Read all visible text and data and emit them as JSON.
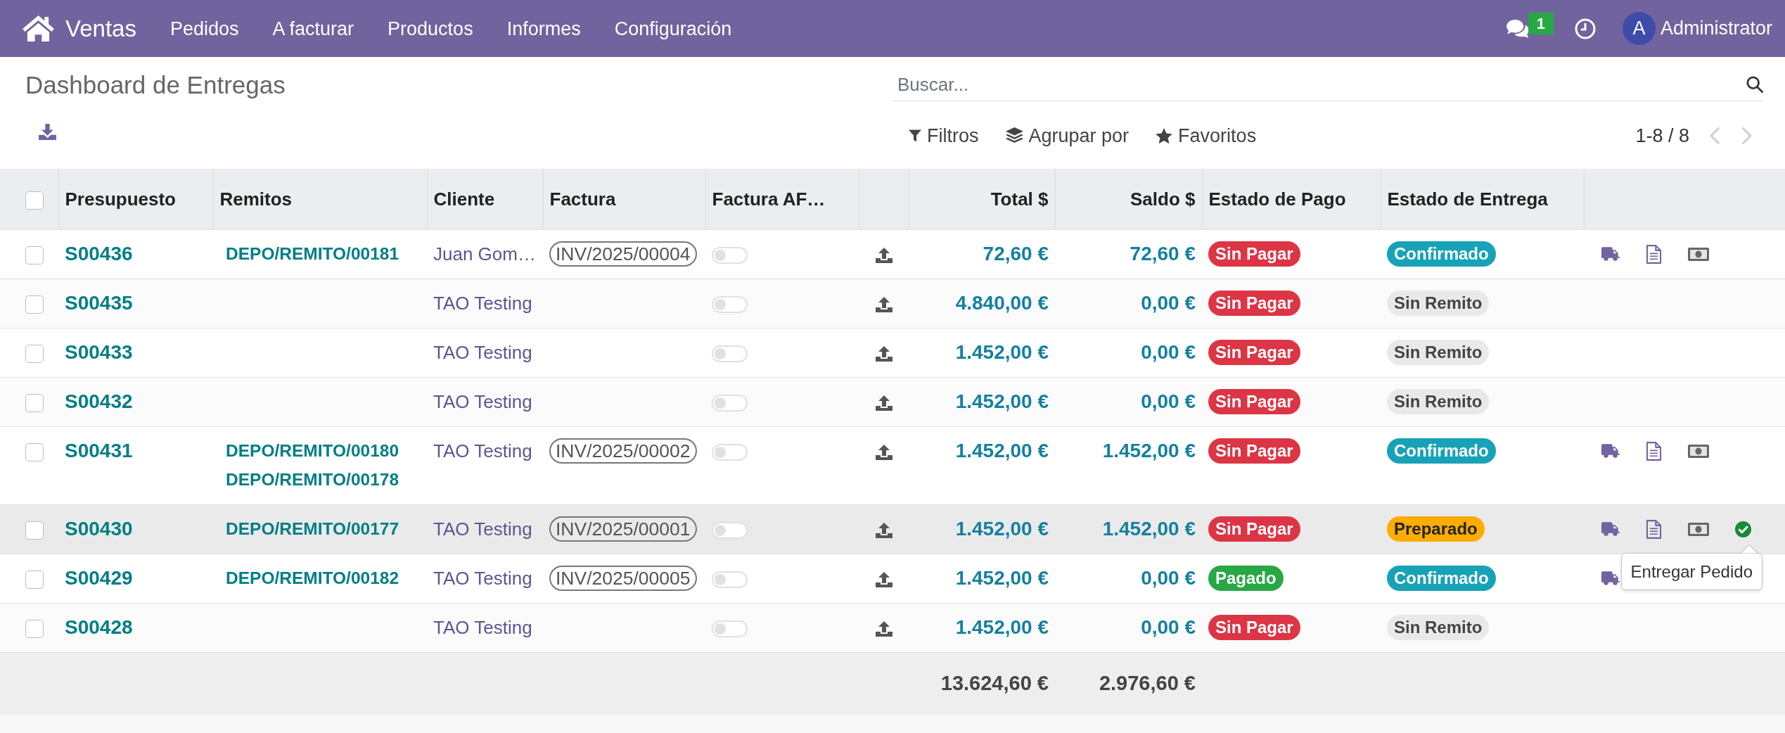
{
  "navbar": {
    "app_name": "Ventas",
    "menu": [
      "Pedidos",
      "A facturar",
      "Productos",
      "Informes",
      "Configuración"
    ],
    "messages_count": "1",
    "user": {
      "initial": "A",
      "name": "Administrator"
    }
  },
  "control_panel": {
    "title": "Dashboard de Entregas",
    "search": {
      "placeholder": "Buscar..."
    },
    "search_options": [
      {
        "kind": "filter",
        "label": "Filtros"
      },
      {
        "kind": "group_by",
        "label": "Agrupar por"
      },
      {
        "kind": "favorites",
        "label": "Favoritos"
      }
    ],
    "pager": {
      "value": "1-8 / 8",
      "previous_disabled": true,
      "next_disabled": true
    }
  },
  "table": {
    "select_all": {
      "checked": false
    },
    "columns": [
      "Presupuesto",
      "Remitos",
      "Cliente",
      "Factura",
      "Factura AF…",
      "Total $",
      "Saldo $",
      "Estado de Pago",
      "Estado de Entrega"
    ],
    "rows": [
      {
        "selected": false,
        "hovered": false,
        "quote": "S00436",
        "delivery_notes": [
          "DEPO/REMITO/00181"
        ],
        "customer": "Juan Gom…",
        "invoice": "INV/2025/00004",
        "toggle_on": false,
        "total": "72,60 €",
        "balance": "72,60 €",
        "payment_status": {
          "label": "Sin Pagar",
          "kind": "danger"
        },
        "delivery_status": {
          "label": "Confirmado",
          "kind": "info"
        },
        "actions": [
          {
            "kind": "delivery_note"
          },
          {
            "kind": "invoice"
          },
          {
            "kind": "payment"
          }
        ]
      },
      {
        "selected": false,
        "hovered": false,
        "quote": "S00435",
        "customer": "TAO Testing",
        "toggle_on": false,
        "total": "4.840,00 €",
        "balance": "0,00 €",
        "payment_status": {
          "label": "Sin Pagar",
          "kind": "danger"
        },
        "delivery_status": {
          "label": "Sin Remito",
          "kind": "muted"
        }
      },
      {
        "selected": false,
        "hovered": false,
        "quote": "S00433",
        "customer": "TAO Testing",
        "toggle_on": false,
        "total": "1.452,00 €",
        "balance": "0,00 €",
        "payment_status": {
          "label": "Sin Pagar",
          "kind": "danger"
        },
        "delivery_status": {
          "label": "Sin Remito",
          "kind": "muted"
        }
      },
      {
        "selected": false,
        "hovered": false,
        "quote": "S00432",
        "customer": "TAO Testing",
        "toggle_on": false,
        "total": "1.452,00 €",
        "balance": "0,00 €",
        "payment_status": {
          "label": "Sin Pagar",
          "kind": "danger"
        },
        "delivery_status": {
          "label": "Sin Remito",
          "kind": "muted"
        }
      },
      {
        "selected": false,
        "hovered": false,
        "quote": "S00431",
        "delivery_notes": [
          "DEPO/REMITO/00180",
          "DEPO/REMITO/00178"
        ],
        "customer": "TAO Testing",
        "invoice": "INV/2025/00002",
        "toggle_on": false,
        "total": "1.452,00 €",
        "balance": "1.452,00 €",
        "payment_status": {
          "label": "Sin Pagar",
          "kind": "danger"
        },
        "delivery_status": {
          "label": "Confirmado",
          "kind": "info"
        },
        "actions": [
          {
            "kind": "delivery_note"
          },
          {
            "kind": "invoice"
          },
          {
            "kind": "payment"
          }
        ]
      },
      {
        "selected": false,
        "hovered": true,
        "quote": "S00430",
        "delivery_notes": [
          "DEPO/REMITO/00177"
        ],
        "customer": "TAO Testing",
        "invoice": "INV/2025/00001",
        "toggle_on": false,
        "total": "1.452,00 €",
        "balance": "1.452,00 €",
        "payment_status": {
          "label": "Sin Pagar",
          "kind": "danger"
        },
        "delivery_status": {
          "label": "Preparado",
          "kind": "warning"
        },
        "actions": [
          {
            "kind": "delivery_note"
          },
          {
            "kind": "invoice"
          },
          {
            "kind": "payment"
          },
          {
            "kind": "deliver",
            "tooltip": "Entregar Pedido"
          }
        ]
      },
      {
        "selected": false,
        "hovered": false,
        "quote": "S00429",
        "delivery_notes": [
          "DEPO/REMITO/00182"
        ],
        "customer": "TAO Testing",
        "invoice": "INV/2025/00005",
        "toggle_on": false,
        "total": "1.452,00 €",
        "balance": "0,00 €",
        "payment_status": {
          "label": "Pagado",
          "kind": "success"
        },
        "delivery_status": {
          "label": "Confirmado",
          "kind": "info"
        },
        "actions": [
          {
            "kind": "delivery_note"
          }
        ]
      },
      {
        "selected": false,
        "hovered": false,
        "quote": "S00428",
        "customer": "TAO Testing",
        "toggle_on": false,
        "total": "1.452,00 €",
        "balance": "0,00 €",
        "payment_status": {
          "label": "Sin Pagar",
          "kind": "danger"
        },
        "delivery_status": {
          "label": "Sin Remito",
          "kind": "muted"
        }
      }
    ],
    "totals": {
      "total": "13.624,60 €",
      "balance": "2.976,60 €"
    }
  }
}
